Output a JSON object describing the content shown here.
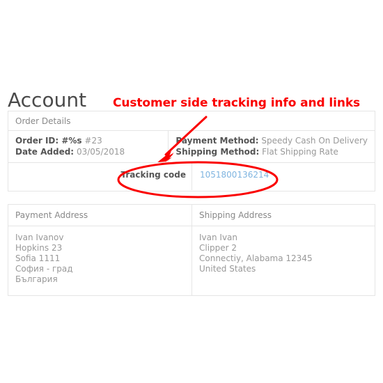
{
  "page": {
    "title": "Account"
  },
  "annotation": {
    "callout_text": "Customer side tracking info and links",
    "color": "#fa0000"
  },
  "order_details": {
    "panel_header": "Order Details",
    "left_column": {
      "order_id_label": "Order ID: #%s",
      "order_id_value": "#23",
      "date_added_label": "Date Added:",
      "date_added_value": "03/05/2018"
    },
    "right_column": {
      "payment_method_label": "Payment Method:",
      "payment_method_value": "Speedy Cash On Delivery",
      "shipping_method_label": "Shipping Method:",
      "shipping_method_value": "Flat Shipping Rate"
    },
    "tracking": {
      "label": "Tracking code",
      "code": "1051800136214",
      "link_color": "#7eb4e0"
    }
  },
  "addresses": {
    "payment": {
      "header": "Payment Address",
      "lines": [
        "Ivan Ivanov",
        "Hopkins 23",
        "Sofia 1111",
        "София - град",
        "България"
      ]
    },
    "shipping": {
      "header": "Shipping Address",
      "lines": [
        "Ivan Ivan",
        "Clipper 2",
        "Connectiy, Alabama 12345",
        "United States"
      ]
    }
  }
}
